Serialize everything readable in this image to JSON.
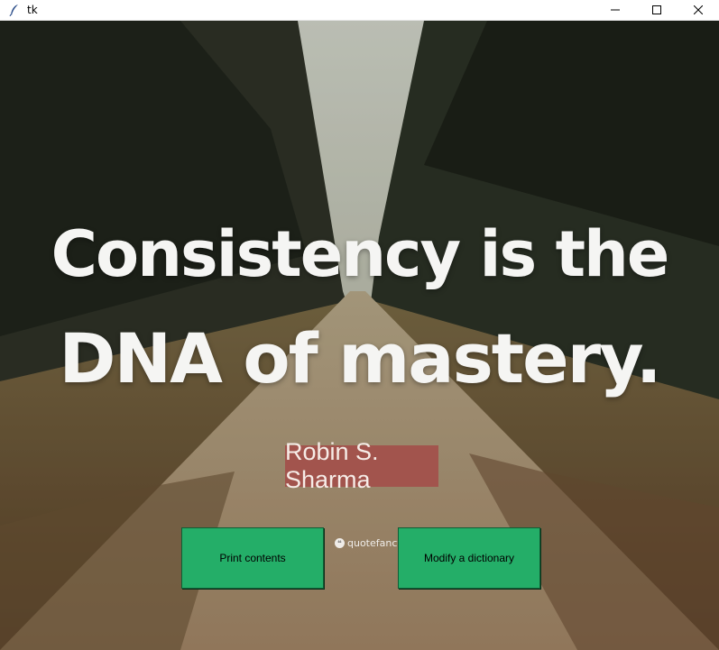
{
  "window": {
    "title": "tk",
    "app_icon": "feather-icon",
    "controls": [
      "minimize-icon",
      "maximize-icon",
      "close-icon"
    ]
  },
  "quote": {
    "line1": "Consistency is the",
    "line2": "DNA of mastery.",
    "author": "Robin S. Sharma",
    "watermark": "quotefancy",
    "author_bg": "#a2544d"
  },
  "buttons": {
    "print_label": "Print contents",
    "modify_label": "Modify a dictionary",
    "color": "#24ae68"
  }
}
